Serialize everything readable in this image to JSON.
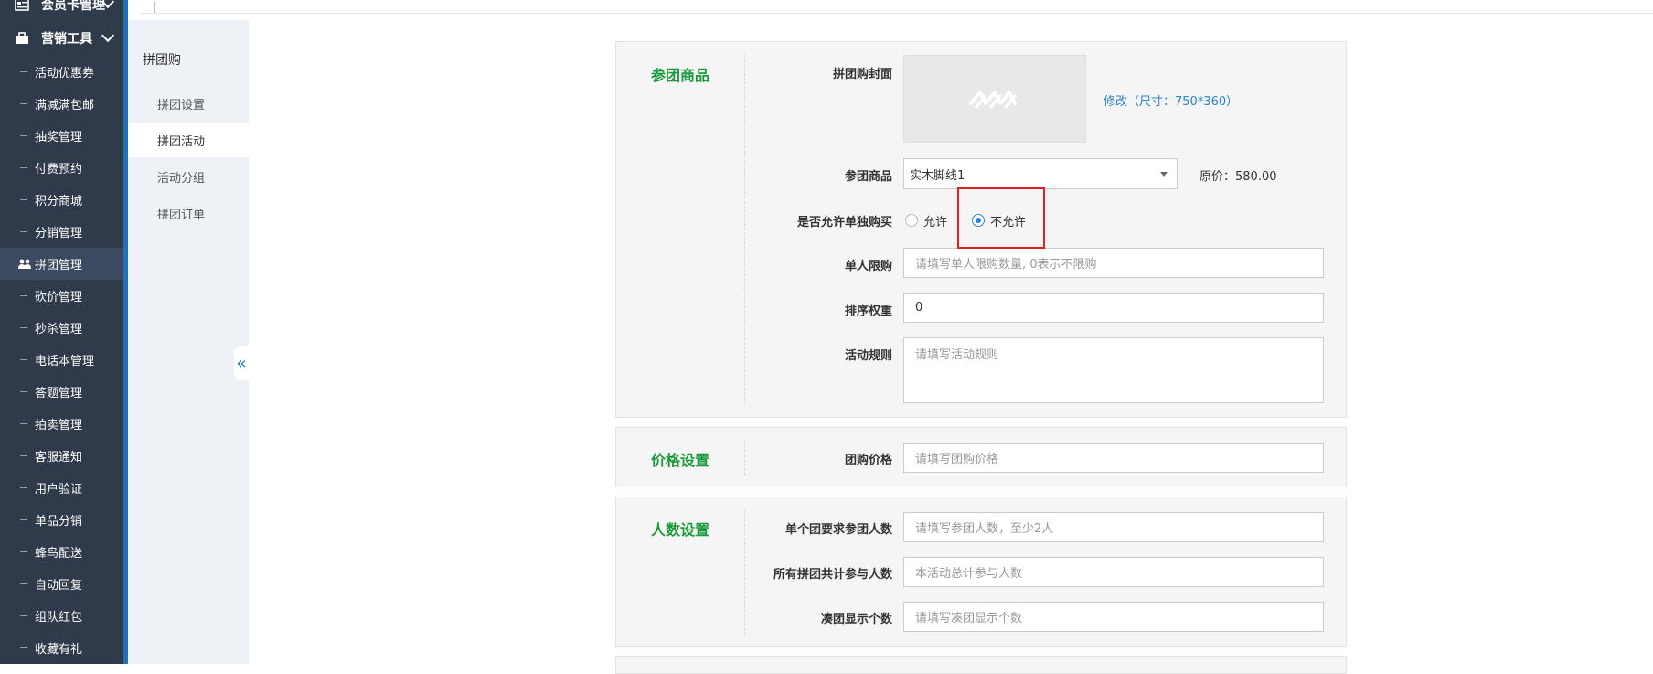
{
  "sidebar": {
    "groups": [
      {
        "label": "会员卡管理",
        "icon": "card-icon"
      },
      {
        "label": "营销工具",
        "icon": "briefcase-icon"
      }
    ],
    "items": [
      {
        "label": "活动优惠券"
      },
      {
        "label": "满减满包邮"
      },
      {
        "label": "抽奖管理"
      },
      {
        "label": "付费预约"
      },
      {
        "label": "积分商城"
      },
      {
        "label": "分销管理"
      },
      {
        "label": "拼团管理",
        "icon": "users-icon",
        "active": true
      },
      {
        "label": "砍价管理"
      },
      {
        "label": "秒杀管理"
      },
      {
        "label": "电话本管理"
      },
      {
        "label": "答题管理"
      },
      {
        "label": "拍卖管理"
      },
      {
        "label": "客服通知"
      },
      {
        "label": "用户验证"
      },
      {
        "label": "单品分销"
      },
      {
        "label": "蜂鸟配送"
      },
      {
        "label": "自动回复"
      },
      {
        "label": "组队红包"
      },
      {
        "label": "收藏有礼"
      }
    ]
  },
  "subnav": {
    "title": "拼团购",
    "items": [
      {
        "label": "拼团设置"
      },
      {
        "label": "拼团活动",
        "active": true
      },
      {
        "label": "活动分组"
      },
      {
        "label": "拼团订单"
      }
    ],
    "collapse_glyph": "«"
  },
  "form": {
    "goods_section": {
      "title": "参团商品",
      "cover_label": "拼团购封面",
      "cover_link": "修改（尺寸：750*360）",
      "goods_label": "参团商品",
      "goods_value": "实木脚线1",
      "original_price": "原价：580.00",
      "single_buy_label": "是否允许单独购买",
      "single_buy_options": [
        "允许",
        "不允许"
      ],
      "single_buy_selected": "不允许",
      "limit_label": "单人限购",
      "limit_placeholder": "请填写单人限购数量, 0表示不限购",
      "sort_label": "排序权重",
      "sort_value": "0",
      "rules_label": "活动规则",
      "rules_placeholder": "请填写活动规则"
    },
    "price_section": {
      "title": "价格设置",
      "price_label": "团购价格",
      "price_placeholder": "请填写团购价格"
    },
    "people_section": {
      "title": "人数设置",
      "group_size_label": "单个团要求参团人数",
      "group_size_placeholder": "请填写参团人数，至少2人",
      "total_label": "所有拼团共计参与人数",
      "total_placeholder": "本活动总计参与人数",
      "display_label": "凑团显示个数",
      "display_placeholder": "请填写凑团显示个数"
    }
  },
  "colors": {
    "sidebar_bg": "#2f3a4a",
    "accent_blue": "#2a84c8",
    "section_green": "#1a9a3a",
    "highlight_red": "#e02020"
  }
}
